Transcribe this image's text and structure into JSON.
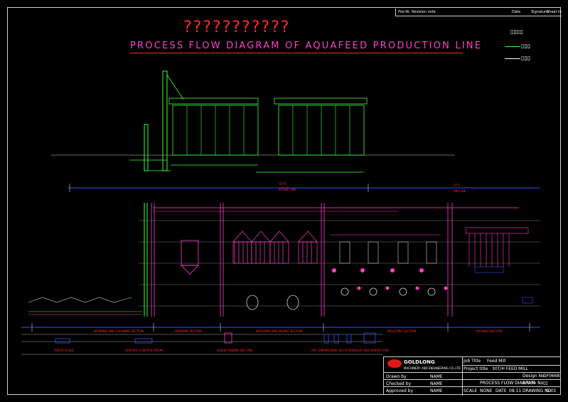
{
  "drawing": {
    "question_marks": "???????????",
    "title": "PROCESS FLOW DIAGRAM OF AQUAFEED PRODUCTION LINE"
  },
  "revision_table": {
    "col1": "Pos-Nr.",
    "col2": "Revision note",
    "col3": "Date",
    "col4": "Signature",
    "col5": "Sheet Id"
  },
  "legend": {
    "header": "▯▯▯▯",
    "item1": "▯▯▯",
    "item2": "▯▯▯",
    "item1_color": "#39ff39",
    "item2_color": "#ffffff"
  },
  "section_labels": {
    "upper_left": "▯▯▯▯▯",
    "upper_left_sub": "INTAKE LINE",
    "upper_right": "▯▯▯▯",
    "upper_right_sub": "BIN LINE",
    "s1": "INTAKING AND CLEANING SECTION",
    "s2": "GRINDING SECTION",
    "s3": "BATCHING AND MIXING SECTION",
    "s4": "PELLETING SECTION",
    "s5": "PACKING SECTION",
    "b1": "TRUCK SCALE",
    "b2": "CENTRAL CONTROL ROOM",
    "b3": "LIQUID ADDING SECTION",
    "b4": "AIR COMPRESSING SECTION",
    "b5": "BOILER AND SUBSECTION"
  },
  "title_block": {
    "company": "GOLDLONG",
    "company_sub": "MACHINERY AND ENGINEERING CO.,LTD",
    "job_title_label": "Job Title",
    "job_title": "Feed Mill",
    "project_label": "Project title",
    "project": "30T/H FEED MILL",
    "drawing_name": "PROCESS FLOW DIAGRAM",
    "drawn_by": "Drawn by",
    "checked_by": "Checked by",
    "approved_by": "Approved by",
    "drawing_no_label": "Design No",
    "drawing_no": "GF0668",
    "scale_label": "SCALE",
    "scale": "NONE",
    "date_label": "DATE",
    "date": "08.11",
    "sheet_label": "DRAWING NO",
    "sheet": "G-01",
    "name_placeholder": "NAME",
    "article_label": "Article No",
    "article": "▯▯"
  }
}
